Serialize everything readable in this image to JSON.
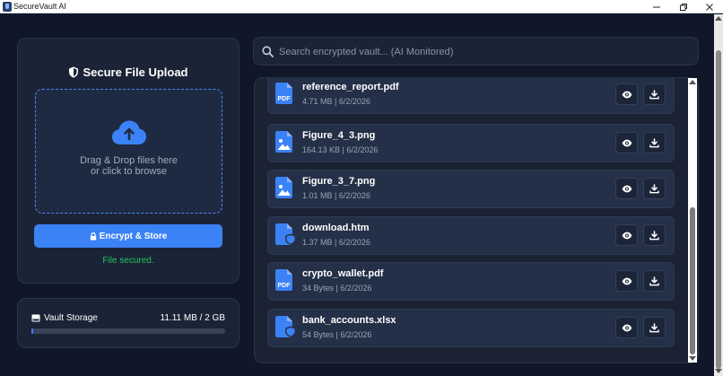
{
  "window": {
    "title": "SecureVault AI"
  },
  "upload": {
    "title": "Secure File Upload",
    "drop_line1": "Drag & Drop files here",
    "drop_line2": "or click to browse",
    "encrypt_label": "Encrypt & Store",
    "status": "File secured."
  },
  "storage": {
    "label": "Vault Storage",
    "value": "11.11 MB / 2 GB",
    "used_fraction": 0.005
  },
  "search": {
    "placeholder": "Search encrypted vault... (AI Monitored)"
  },
  "files": [
    {
      "name": "reference_report.pdf",
      "meta": "4.71 MB | 6/2/2026",
      "icon": "pdf-file-icon"
    },
    {
      "name": "Figure_4_3.png",
      "meta": "164.13 KB | 6/2/2026",
      "icon": "image-file-icon"
    },
    {
      "name": "Figure_3_7.png",
      "meta": "1.01 MB | 6/2/2026",
      "icon": "image-file-icon"
    },
    {
      "name": "download.htm",
      "meta": "1.37 MB | 6/2/2026",
      "icon": "shield-file-icon"
    },
    {
      "name": "crypto_wallet.pdf",
      "meta": "34 Bytes | 6/2/2026",
      "icon": "pdf-file-icon"
    },
    {
      "name": "bank_accounts.xlsx",
      "meta": "54 Bytes | 6/2/2026",
      "icon": "shield-file-icon"
    }
  ],
  "colors": {
    "accent": "#3b82f6",
    "success": "#22c55e",
    "background": "#0f1729",
    "card": "#1b2436"
  }
}
